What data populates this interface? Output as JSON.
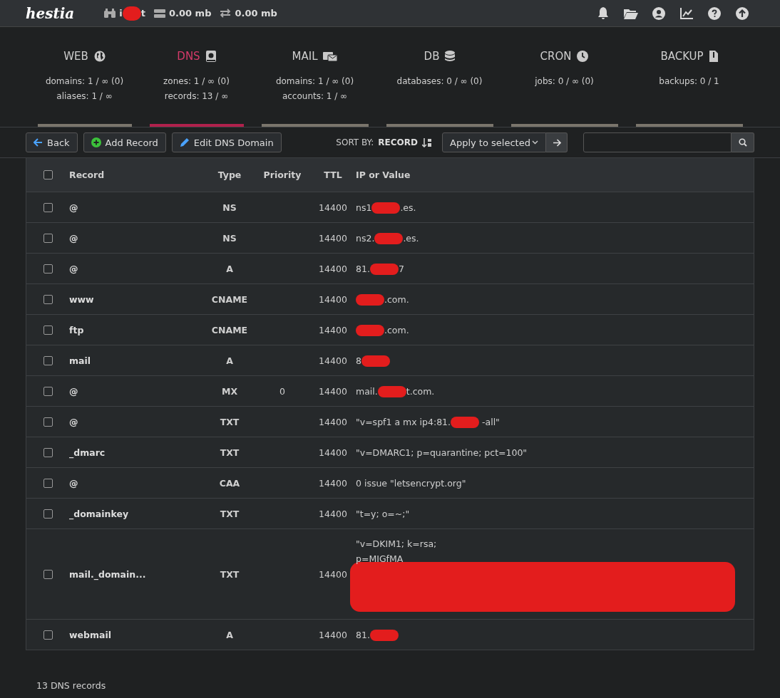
{
  "topbar": {
    "logo": "hestia",
    "user": [
      {
        "kind": "text",
        "text": "i"
      },
      {
        "kind": "redaction"
      },
      {
        "kind": "text",
        "text": "t"
      }
    ],
    "disk": "0.00 mb",
    "bandwidth": "0.00 mb"
  },
  "sections": [
    {
      "title": "WEB",
      "kind": "globe",
      "selected": false,
      "stats": [
        "domains: 1 / ∞ (0)",
        "aliases: 1 / ∞"
      ]
    },
    {
      "title": "DNS",
      "kind": "book",
      "selected": true,
      "stats": [
        "zones: 1 / ∞ (0)",
        "records: 13 / ∞"
      ]
    },
    {
      "title": "MAIL",
      "kind": "mail",
      "selected": false,
      "stats": [
        "domains: 1 / ∞ (0)",
        "accounts: 1 / ∞"
      ]
    },
    {
      "title": "DB",
      "kind": "database",
      "selected": false,
      "stats": [
        "databases: 0 / ∞ (0)"
      ]
    },
    {
      "title": "CRON",
      "kind": "clock",
      "selected": false,
      "stats": [
        "jobs: 0 / ∞ (0)"
      ]
    },
    {
      "title": "BACKUP",
      "kind": "file",
      "selected": false,
      "stats": [
        "backups: 0 / 1"
      ]
    }
  ],
  "toolbar": {
    "back": "Back",
    "add": "Add Record",
    "edit": "Edit DNS Domain",
    "sort_label": "SORT BY:",
    "sort_value": "RECORD",
    "bulk": "Apply to selected"
  },
  "table": {
    "columns": [
      "Record",
      "Type",
      "Priority",
      "TTL",
      "IP or Value"
    ],
    "header_checked": false,
    "rows": [
      {
        "record": "@",
        "type": "NS",
        "priority": "",
        "ttl": "14400",
        "checked": false,
        "value": [
          [
            {
              "kind": "text",
              "text": "ns1"
            },
            {
              "kind": "redaction"
            },
            {
              "kind": "text",
              "text": ".es."
            }
          ]
        ]
      },
      {
        "record": "@",
        "type": "NS",
        "priority": "",
        "ttl": "14400",
        "checked": false,
        "value": [
          [
            {
              "kind": "text",
              "text": "ns2."
            },
            {
              "kind": "redaction"
            },
            {
              "kind": "text",
              "text": ".es."
            }
          ]
        ]
      },
      {
        "record": "@",
        "type": "A",
        "priority": "",
        "ttl": "14400",
        "checked": false,
        "value": [
          [
            {
              "kind": "text",
              "text": "81."
            },
            {
              "kind": "redaction"
            },
            {
              "kind": "text",
              "text": "7"
            }
          ]
        ]
      },
      {
        "record": "www",
        "type": "CNAME",
        "priority": "",
        "ttl": "14400",
        "checked": false,
        "value": [
          [
            {
              "kind": "redaction"
            },
            {
              "kind": "text",
              "text": ".com."
            }
          ]
        ]
      },
      {
        "record": "ftp",
        "type": "CNAME",
        "priority": "",
        "ttl": "14400",
        "checked": false,
        "value": [
          [
            {
              "kind": "redaction"
            },
            {
              "kind": "text",
              "text": ".com."
            }
          ]
        ]
      },
      {
        "record": "mail",
        "type": "A",
        "priority": "",
        "ttl": "14400",
        "checked": false,
        "value": [
          [
            {
              "kind": "text",
              "text": "8"
            },
            {
              "kind": "redaction"
            }
          ]
        ]
      },
      {
        "record": "@",
        "type": "MX",
        "priority": "0",
        "ttl": "14400",
        "checked": false,
        "value": [
          [
            {
              "kind": "text",
              "text": "mail."
            },
            {
              "kind": "redaction"
            },
            {
              "kind": "text",
              "text": "t.com."
            }
          ]
        ]
      },
      {
        "record": "@",
        "type": "TXT",
        "priority": "",
        "ttl": "14400",
        "checked": false,
        "value": [
          [
            {
              "kind": "text",
              "text": "\"v=spf1 a mx ip4:81."
            },
            {
              "kind": "redaction"
            },
            {
              "kind": "text",
              "text": " -all\""
            }
          ]
        ]
      },
      {
        "record": "_dmarc",
        "type": "TXT",
        "priority": "",
        "ttl": "14400",
        "checked": false,
        "value": [
          [
            {
              "kind": "text",
              "text": "\"v=DMARC1; p=quarantine; pct=100\""
            }
          ]
        ]
      },
      {
        "record": "@",
        "type": "CAA",
        "priority": "",
        "ttl": "14400",
        "checked": false,
        "value": [
          [
            {
              "kind": "text",
              "text": "0 issue \"letsencrypt.org\""
            }
          ]
        ]
      },
      {
        "record": "_domainkey",
        "type": "TXT",
        "priority": "",
        "ttl": "14400",
        "checked": false,
        "value": [
          [
            {
              "kind": "text",
              "text": "\"t=y; o=~;\""
            }
          ]
        ]
      },
      {
        "record": "mail._domain...",
        "type": "TXT",
        "priority": "",
        "ttl": "14400",
        "checked": false,
        "value": [
          [
            {
              "kind": "text",
              "text": "\"v=DKIM1; k=rsa;"
            }
          ],
          [
            {
              "kind": "text",
              "text": "p=MIGfMA"
            },
            {
              "kind": "redaction_block"
            }
          ]
        ]
      },
      {
        "record": "webmail",
        "type": "A",
        "priority": "",
        "ttl": "14400",
        "checked": false,
        "value": [
          [
            {
              "kind": "text",
              "text": "81."
            },
            {
              "kind": "redaction"
            }
          ]
        ]
      }
    ]
  },
  "footer": "13 DNS records"
}
